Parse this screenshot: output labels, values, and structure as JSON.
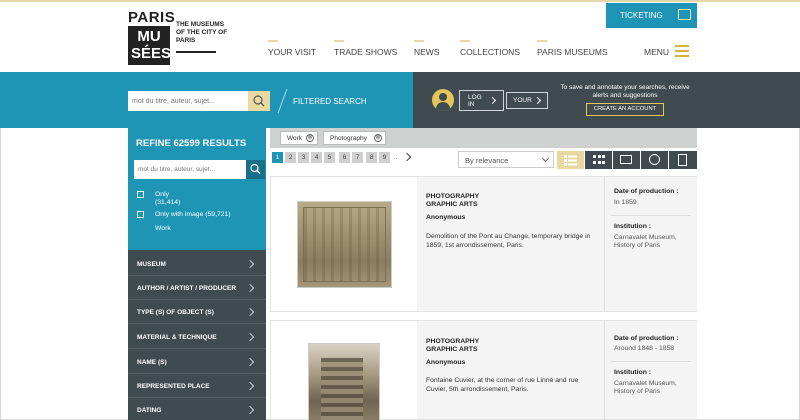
{
  "logo": {
    "line1": "PARIS",
    "line2": "MU",
    "line3": "SÉES",
    "tagline": "THE MUSEUMS OF THE CITY OF PARIS"
  },
  "header": {
    "ticketing": "TICKETING",
    "nav": [
      "YOUR VISIT",
      "TRADE SHOWS",
      "NEWS",
      "COLLECTIONS",
      "PARIS MUSEUMS"
    ],
    "menu": "MENU"
  },
  "search": {
    "placeholder": "mot du titre, auteur, sujet...",
    "filtered_search": "FILTERED SEARCH"
  },
  "account": {
    "login": "LOG IN",
    "your": "YOUR",
    "save_text": "To save and annotate your searches, receive alerts and suggestions",
    "create": "CREATE AN ACCOUNT"
  },
  "sidebar": {
    "refine_title": "REFINE 62599 RESULTS",
    "search_placeholder": "mot du titre, auteur, sujet...",
    "options": [
      {
        "label": "Only",
        "count": "(31,414)"
      },
      {
        "label": "Only with image (59,721)"
      },
      {
        "label": "Work"
      }
    ],
    "facets": [
      "MUSEUM",
      "AUTHOR / ARTIST / PRODUCER",
      "TYPE (S) OF OBJECT (S)",
      "MATERIAL & TECHNIQUE",
      "NAME (S)",
      "REPRESENTED PLACE",
      "DATING"
    ]
  },
  "filters": {
    "chips": [
      "Work",
      "Photography"
    ],
    "chip_close": "⊗"
  },
  "pagination": {
    "pages": [
      "1",
      "2",
      "3",
      "4",
      "5",
      "6",
      "7",
      "8",
      "9"
    ],
    "dots": "..",
    "active": "1"
  },
  "sort": {
    "selected": "By relevance"
  },
  "results": [
    {
      "category1": "PHOTOGRAPHY",
      "category2": "GRAPHIC ARTS",
      "author": "Anonymous",
      "description": "Demolition of the Pont au Change, temporary bridge in 1859, 1st arrondissement, Paris.",
      "date_label": "Date of production :",
      "date": "In 1859",
      "institution_label": "Institution :",
      "institution": "Carnavalet Museum, History of Paris"
    },
    {
      "category1": "PHOTOGRAPHY",
      "category2": "GRAPHIC ARTS",
      "author": "Anonymous",
      "description": "Fontaine Cuvier, at the corner of rue Linné and rue Cuvier, 5th arrondissement, Paris.",
      "date_label": "Date of production :",
      "date": "Around 1848 - 1858",
      "institution_label": "Institution :",
      "institution": "Carnavalet Museum, History of Paris"
    }
  ],
  "colors": {
    "accent_blue": "#1e95b5",
    "dark": "#3f4b4e",
    "gold": "#e4c65a"
  }
}
